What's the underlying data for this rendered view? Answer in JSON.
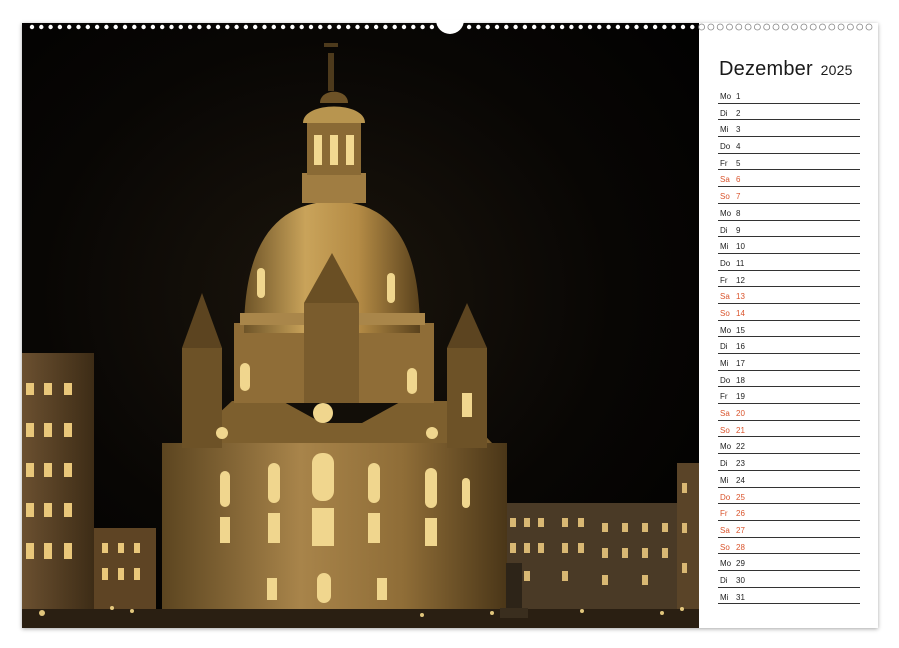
{
  "calendar": {
    "month": "Dezember",
    "year": "2025",
    "days": [
      {
        "weekday": "Mo",
        "day": "1",
        "highlight": false
      },
      {
        "weekday": "Di",
        "day": "2",
        "highlight": false
      },
      {
        "weekday": "Mi",
        "day": "3",
        "highlight": false
      },
      {
        "weekday": "Do",
        "day": "4",
        "highlight": false
      },
      {
        "weekday": "Fr",
        "day": "5",
        "highlight": false
      },
      {
        "weekday": "Sa",
        "day": "6",
        "highlight": true
      },
      {
        "weekday": "So",
        "day": "7",
        "highlight": true
      },
      {
        "weekday": "Mo",
        "day": "8",
        "highlight": false
      },
      {
        "weekday": "Di",
        "day": "9",
        "highlight": false
      },
      {
        "weekday": "Mi",
        "day": "10",
        "highlight": false
      },
      {
        "weekday": "Do",
        "day": "11",
        "highlight": false
      },
      {
        "weekday": "Fr",
        "day": "12",
        "highlight": false
      },
      {
        "weekday": "Sa",
        "day": "13",
        "highlight": true
      },
      {
        "weekday": "So",
        "day": "14",
        "highlight": true
      },
      {
        "weekday": "Mo",
        "day": "15",
        "highlight": false
      },
      {
        "weekday": "Di",
        "day": "16",
        "highlight": false
      },
      {
        "weekday": "Mi",
        "day": "17",
        "highlight": false
      },
      {
        "weekday": "Do",
        "day": "18",
        "highlight": false
      },
      {
        "weekday": "Fr",
        "day": "19",
        "highlight": false
      },
      {
        "weekday": "Sa",
        "day": "20",
        "highlight": true
      },
      {
        "weekday": "So",
        "day": "21",
        "highlight": true
      },
      {
        "weekday": "Mo",
        "day": "22",
        "highlight": false
      },
      {
        "weekday": "Di",
        "day": "23",
        "highlight": false
      },
      {
        "weekday": "Mi",
        "day": "24",
        "highlight": false
      },
      {
        "weekday": "Do",
        "day": "25",
        "highlight": true
      },
      {
        "weekday": "Fr",
        "day": "26",
        "highlight": true
      },
      {
        "weekday": "Sa",
        "day": "27",
        "highlight": true
      },
      {
        "weekday": "So",
        "day": "28",
        "highlight": true
      },
      {
        "weekday": "Mo",
        "day": "29",
        "highlight": false
      },
      {
        "weekday": "Di",
        "day": "30",
        "highlight": false
      },
      {
        "weekday": "Mi",
        "day": "31",
        "highlight": false
      }
    ]
  },
  "colors": {
    "highlight": "#d9542c",
    "text": "#222222",
    "night_sky": "#000000",
    "stone_lit": "#c9a35a"
  },
  "photo": {
    "subject": "frauenkirche-dresden-night-photo"
  }
}
